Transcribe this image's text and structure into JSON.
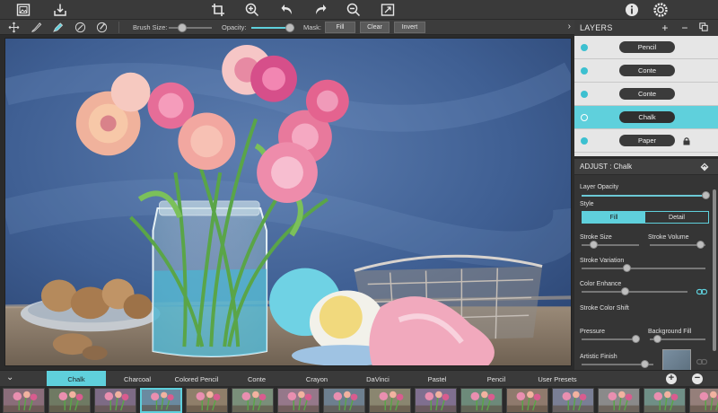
{
  "colors": {
    "accent": "#5fd0dc",
    "panel": "#353535",
    "toolbar": "#3a3a3a"
  },
  "toolbar": {
    "icons": [
      "gallery-icon",
      "save-icon",
      "crop-icon",
      "zoom-in-icon",
      "undo-icon",
      "redo-icon",
      "zoom-out-icon",
      "fit-screen-icon",
      "info-icon",
      "settings-icon"
    ]
  },
  "brush_options": {
    "brush_size_label": "Brush Size:",
    "brush_size_value": 0.25,
    "opacity_label": "Opacity:",
    "opacity_value": 0.9,
    "mask_label": "Mask:",
    "fill_label": "Fill",
    "clear_label": "Clear",
    "invert_label": "Invert"
  },
  "layers": {
    "title": "LAYERS",
    "add_symbol": "+",
    "remove_symbol": "−",
    "items": [
      {
        "label": "Pencil",
        "active": false,
        "locked": false
      },
      {
        "label": "Conte",
        "active": false,
        "locked": false
      },
      {
        "label": "Conte",
        "active": false,
        "locked": false
      },
      {
        "label": "Chalk",
        "active": true,
        "locked": false
      },
      {
        "label": "Paper",
        "active": false,
        "locked": true
      }
    ]
  },
  "adjust": {
    "title": "ADJUST : Chalk",
    "layer_opacity_label": "Layer Opacity",
    "layer_opacity_value": 0.96,
    "style_label": "Style",
    "style_fill": "Fill",
    "style_detail": "Detail",
    "stroke_size_label": "Stroke Size",
    "stroke_size_value": 0.2,
    "stroke_volume_label": "Stroke Volume",
    "stroke_volume_value": 0.85,
    "stroke_variation_label": "Stroke Variation",
    "stroke_variation_value": 0.35,
    "color_enhance_label": "Color Enhance",
    "color_enhance_value": 0.38,
    "stroke_color_shift_label": "Stroke Color Shift",
    "pressure_label": "Pressure",
    "pressure_value": 0.9,
    "background_fill_label": "Background Fill",
    "background_fill_value": 0.1,
    "artistic_finish_label": "Artistic Finish",
    "artistic_finish_value": 0.85
  },
  "presets": {
    "tabs": [
      "Chalk",
      "Charcoal",
      "Colored Pencil",
      "Conte",
      "Crayon",
      "DaVinci",
      "Pastel",
      "Pencil",
      "User Presets"
    ],
    "active": "Chalk",
    "add_symbol": "+",
    "remove_symbol": "−"
  }
}
